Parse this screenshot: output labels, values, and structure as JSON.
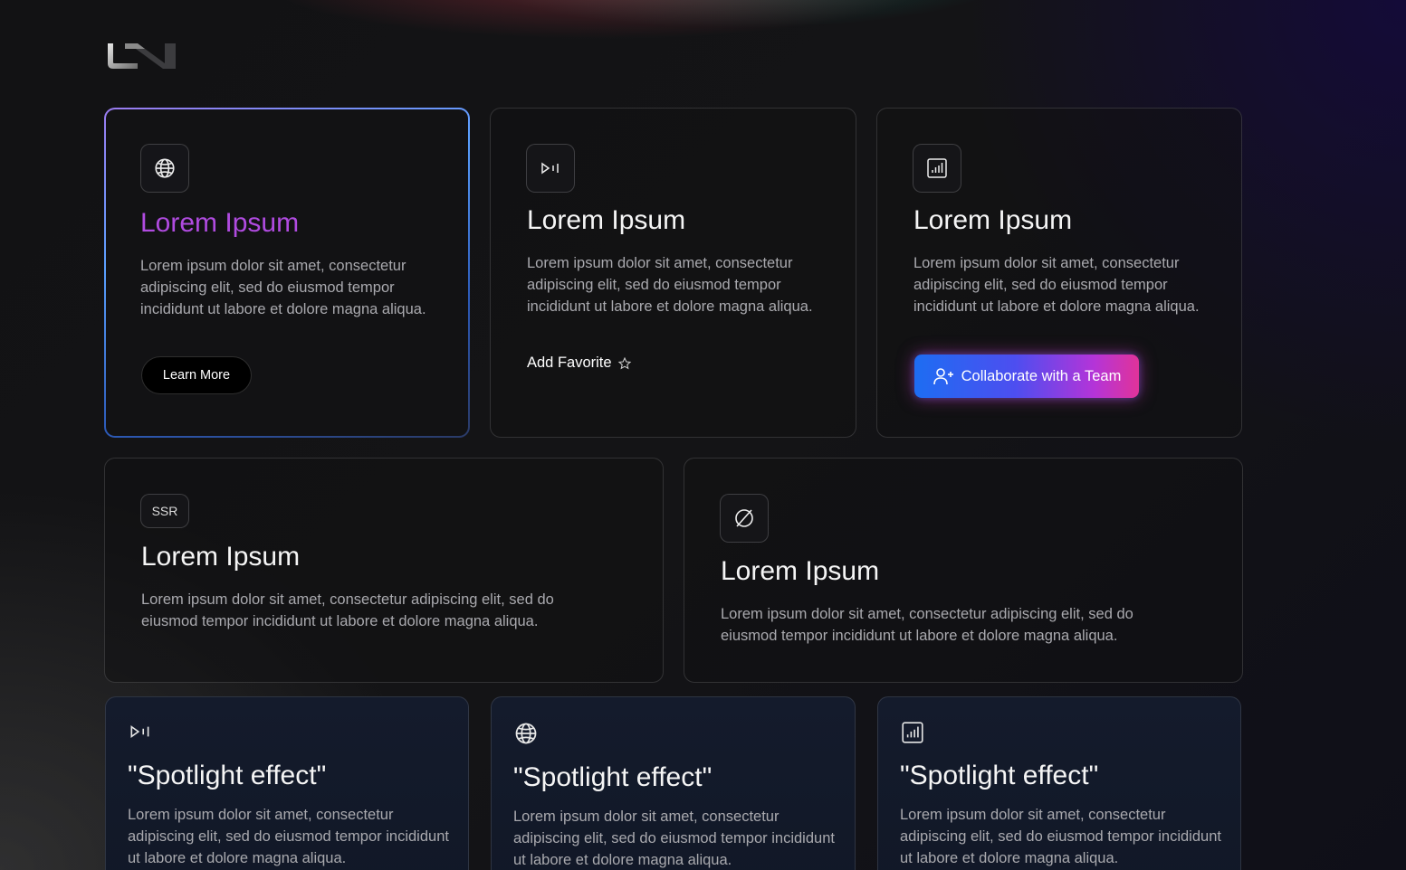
{
  "logo": {
    "name": "brand-logo"
  },
  "cards": [
    {
      "title": "Lorem Ipsum",
      "icon": "globe-icon",
      "text": "Lorem ipsum dolor sit amet, consectetur adipiscing elit, sed do eiusmod tempor incididunt ut labore et dolore magna aliqua.",
      "button": "Learn More",
      "title_color": "#b04be0"
    },
    {
      "title": "Lorem Ipsum",
      "icon": "play-pause-icon",
      "text": "Lorem ipsum dolor sit amet, consectetur adipiscing elit, sed do eiusmod tempor incididunt ut labore et dolore magna aliqua.",
      "link": "Add Favorite"
    },
    {
      "title": "Lorem Ipsum",
      "icon": "bar-chart-icon",
      "text": "Lorem ipsum dolor sit amet, consectetur adipiscing elit, sed do eiusmod tempor incididunt ut labore et dolore magna aliqua.",
      "button": "Collaborate with a Team"
    },
    {
      "title": "Lorem Ipsum",
      "icon": "ssr-icon",
      "icon_text": "SSR",
      "text": "Lorem ipsum dolor sit amet, consectetur adipiscing elit, sed do eiusmod tempor incididunt ut labore et dolore magna aliqua."
    },
    {
      "title": "Lorem Ipsum",
      "icon": "empty-set-icon",
      "text": "Lorem ipsum dolor sit amet, consectetur adipiscing elit, sed do eiusmod tempor incididunt ut labore et dolore magna aliqua."
    }
  ],
  "spotlight": [
    {
      "title": "\"Spotlight effect\"",
      "icon": "play-pause-icon",
      "text": "Lorem ipsum dolor sit amet, consectetur adipiscing elit, sed do eiusmod tempor incididunt ut labore et dolore magna aliqua."
    },
    {
      "title": "\"Spotlight effect\"",
      "icon": "globe-icon",
      "text": "Lorem ipsum dolor sit amet, consectetur adipiscing elit, sed do eiusmod tempor incididunt ut labore et dolore magna aliqua."
    },
    {
      "title": "\"Spotlight effect\"",
      "icon": "bar-chart-icon",
      "text": "Lorem ipsum dolor sit amet, consectetur adipiscing elit, sed do eiusmod tempor incididunt ut labore et dolore magna aliqua."
    }
  ],
  "colors": {
    "accent_purple": "#b04be0",
    "accent_blue": "#1d6df2",
    "accent_pink": "#e0339a"
  }
}
